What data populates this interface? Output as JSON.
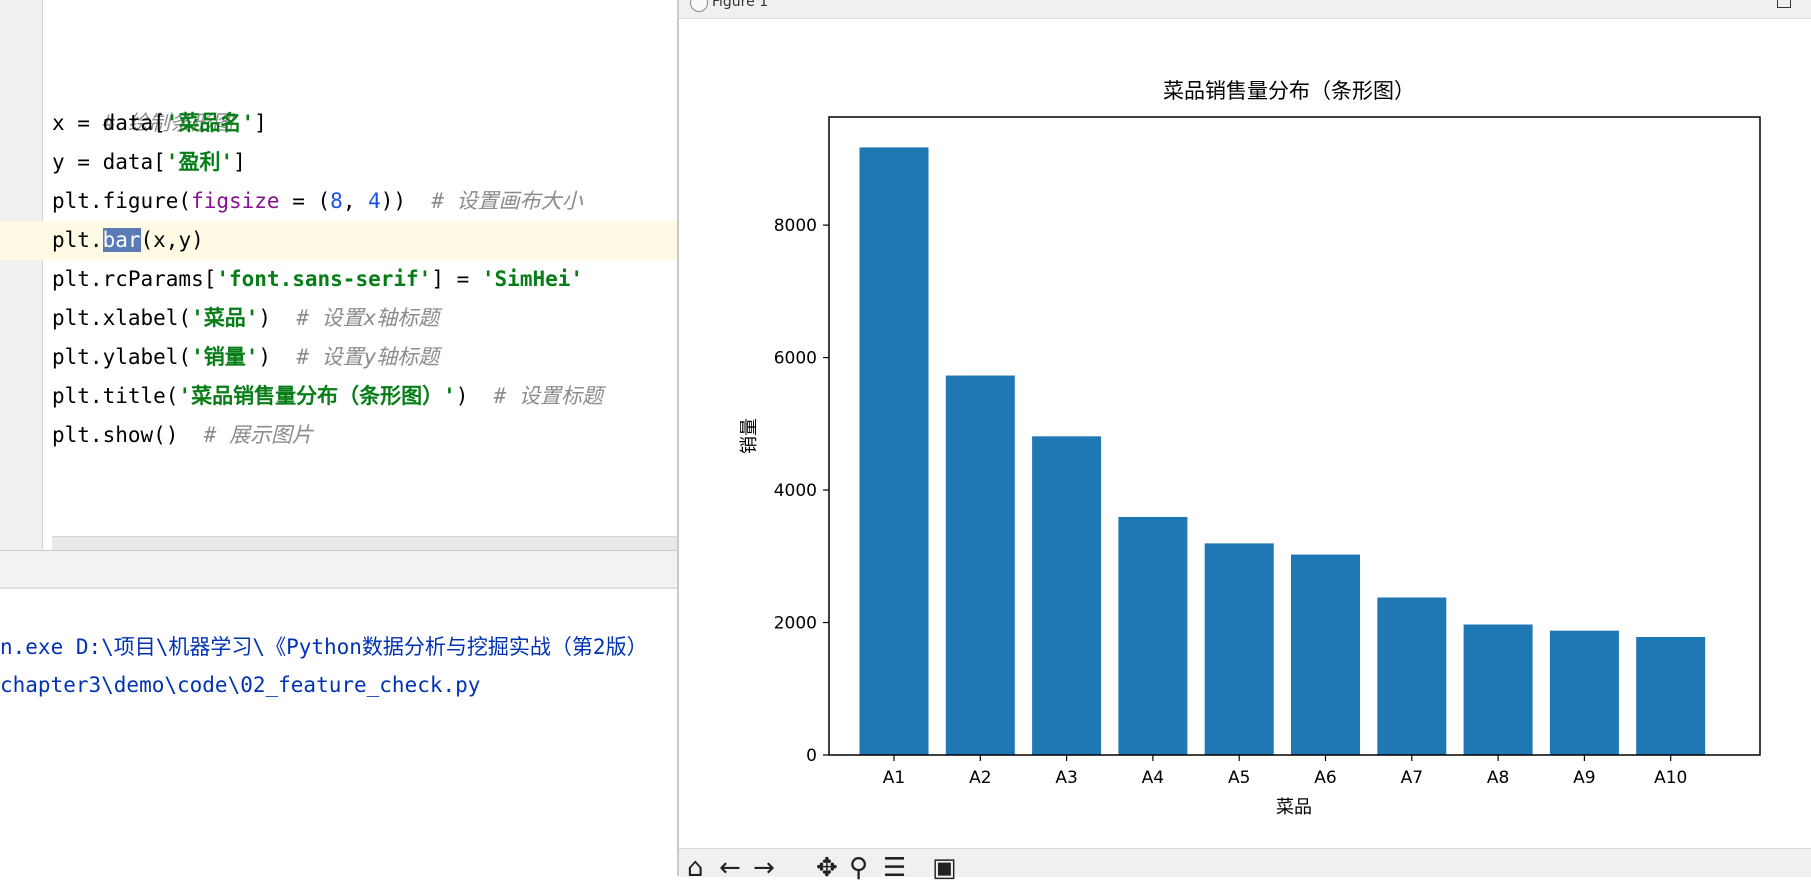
{
  "editor": {
    "lines": [
      {
        "text": "# 绘制条形图"
      },
      {
        "p1": "x = data[",
        "s": "'菜品名'",
        "p2": "]"
      },
      {
        "p1": "y = data[",
        "s": "'盈利'",
        "p2": "]"
      },
      {
        "p1": "plt.figure(",
        "kw": "figsize",
        "p2": " = (",
        "n1": "8",
        "p3": ", ",
        "n2": "4",
        "p4": "))  ",
        "c": "# 设置画布大小"
      },
      {
        "p1": "plt.",
        "sel": "bar",
        "p2": "(x,y)"
      },
      {
        "p1": "plt.rcParams[",
        "s1": "'font.sans-serif'",
        "p2": "] = ",
        "s2": "'SimHei'"
      },
      {
        "p1": "plt.xlabel(",
        "s": "'菜品'",
        "p2": ")  ",
        "c": "# 设置x轴标题"
      },
      {
        "p1": "plt.ylabel(",
        "s": "'销量'",
        "p2": ")  ",
        "c": "# 设置y轴标题"
      },
      {
        "p1": "plt.title(",
        "s": "'菜品销售量分布（条形图）'",
        "p2": ")  ",
        "c": "# 设置标题"
      },
      {
        "p1": "plt.show()  ",
        "c": "# 展示图片"
      }
    ]
  },
  "console": {
    "lines": [
      "n.exe D:\\项目\\机器学习\\《Python数据分析与挖掘实战（第2版）",
      "chapter3\\demo\\code\\02_feature_check.py"
    ]
  },
  "figure_window": {
    "title": "Figure 1"
  },
  "colors": {
    "bar": "#1f77b4",
    "string": "#067d17",
    "number": "#1750eb",
    "keyword": "#871094",
    "comment": "#8c8c8c",
    "console_text": "#0033b3"
  },
  "chart_data": {
    "type": "bar",
    "title": "菜品销售量分布（条形图）",
    "xlabel": "菜品",
    "ylabel": "销量",
    "categories": [
      "A1",
      "A2",
      "A3",
      "A4",
      "A5",
      "A6",
      "A7",
      "A8",
      "A9",
      "A10"
    ],
    "values": [
      9173,
      5729,
      4811,
      3594,
      3195,
      3026,
      2378,
      1970,
      1877,
      1782
    ],
    "ylim": [
      0,
      9632
    ],
    "yticks": [
      0,
      2000,
      4000,
      6000,
      8000
    ],
    "grid": false,
    "legend": "none"
  }
}
